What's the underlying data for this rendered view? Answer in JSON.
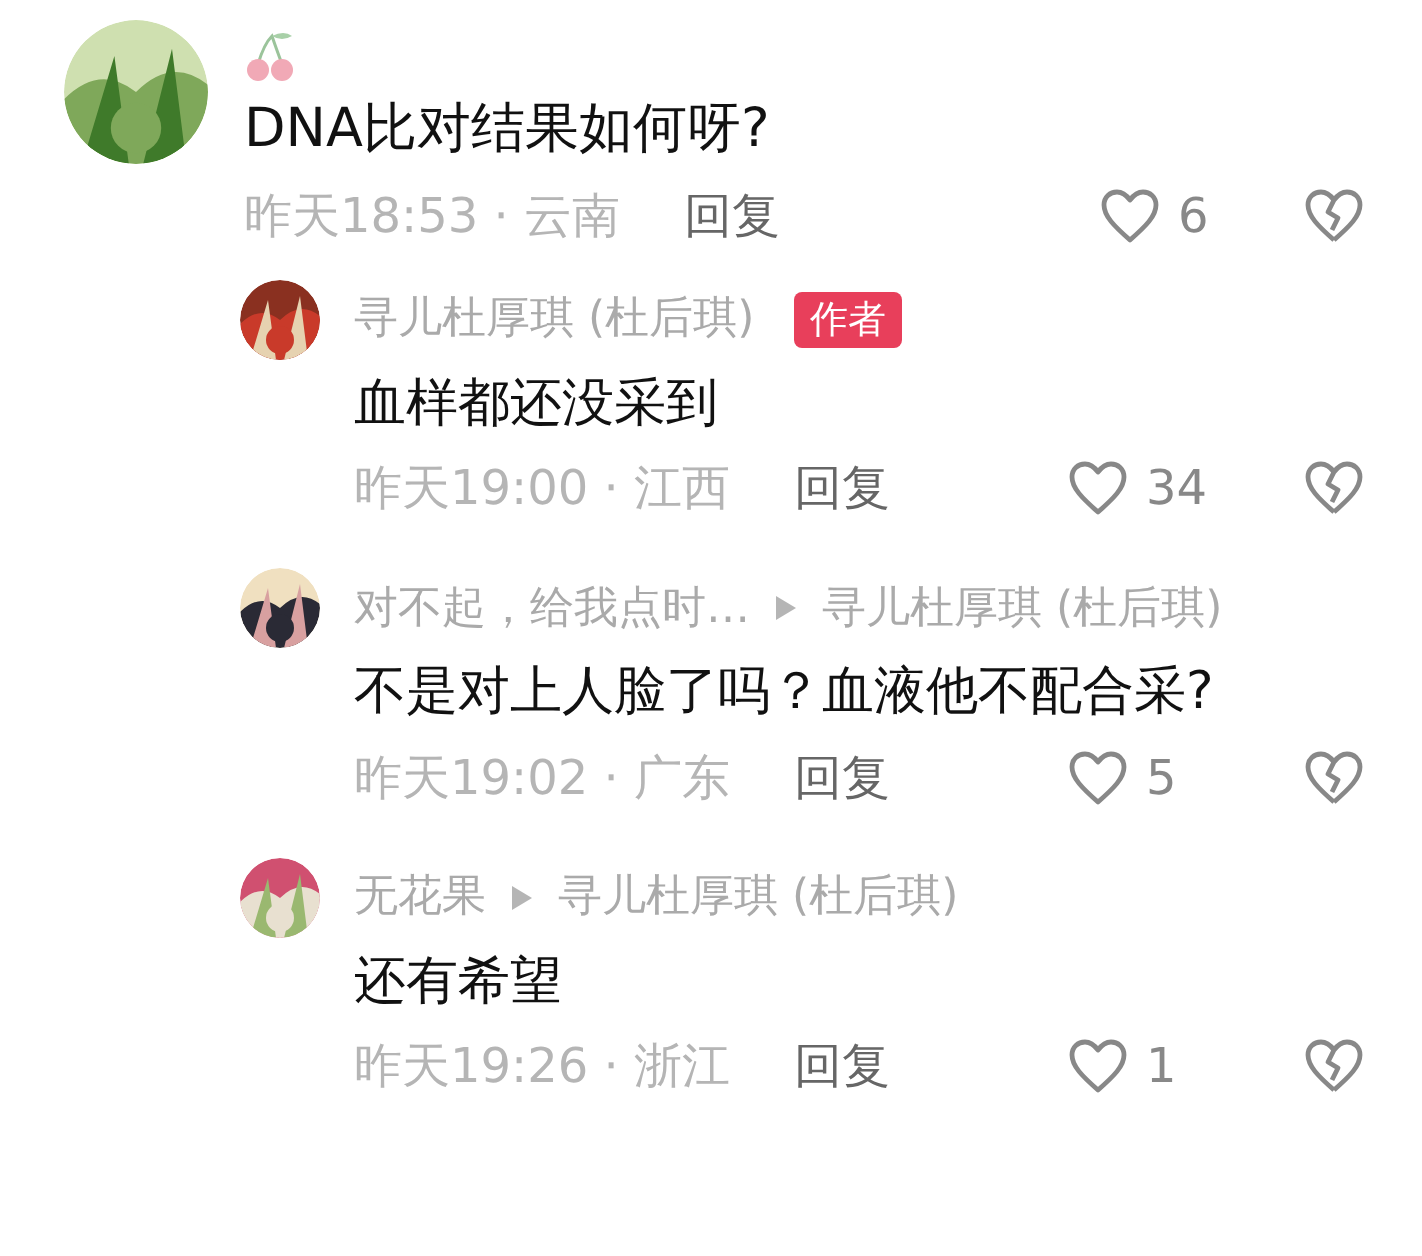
{
  "comment": {
    "text": "DNA比对结果如何呀?",
    "time_region": "昨天18:53 · 云南",
    "reply": "回复",
    "likes": "6"
  },
  "replies": [
    {
      "author": "寻儿杜厚琪 (杜后琪)",
      "badge": "作者",
      "text": "血样都还没采到",
      "time_region": "昨天19:00 · 江西",
      "reply": "回复",
      "likes": "34"
    },
    {
      "author": "对不起，给我点时…",
      "reply_to": "寻儿杜厚琪 (杜后琪)",
      "text": "不是对上人脸了吗？血液他不配合采?",
      "time_region": "昨天19:02 · 广东",
      "reply": "回复",
      "likes": "5"
    },
    {
      "author": "无花果",
      "reply_to": "寻儿杜厚琪 (杜后琪)",
      "text": "还有希望",
      "time_region": "昨天19:26 · 浙江",
      "reply": "回复",
      "likes": "1"
    }
  ]
}
